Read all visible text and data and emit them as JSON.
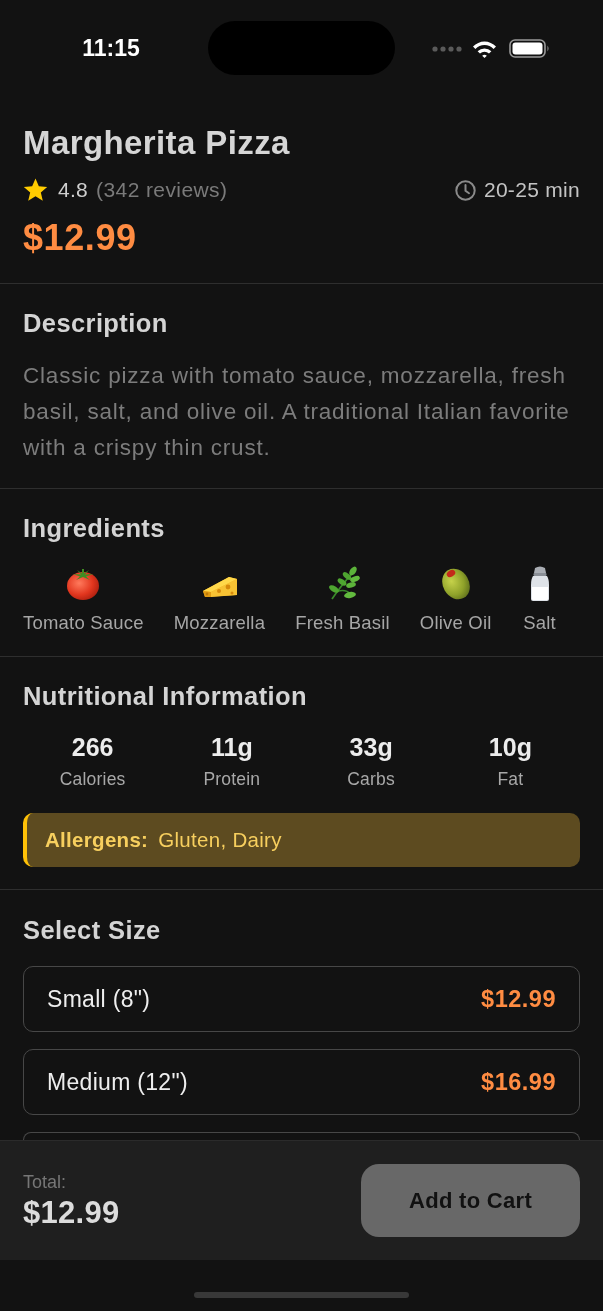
{
  "status_bar": {
    "time": "11:15"
  },
  "item": {
    "title": "Margherita Pizza",
    "rating": "4.8",
    "reviews": "(342 reviews)",
    "prep_time": "20-25 min",
    "price": "$12.99"
  },
  "description": {
    "heading": "Description",
    "text": "Classic pizza with tomato sauce, mozzarella, fresh basil, salt, and olive oil. A traditional Italian favorite with a crispy thin crust."
  },
  "ingredients": {
    "heading": "Ingredients",
    "items": [
      {
        "kind": "tomato",
        "name": "Tomato Sauce"
      },
      {
        "kind": "cheese",
        "name": "Mozzarella"
      },
      {
        "kind": "herb",
        "name": "Fresh Basil"
      },
      {
        "kind": "olive",
        "name": "Olive Oil"
      },
      {
        "kind": "salt",
        "name": "Salt"
      }
    ]
  },
  "nutrition": {
    "heading": "Nutritional Information",
    "facts": [
      {
        "value": "266",
        "label": "Calories"
      },
      {
        "value": "11g",
        "label": "Protein"
      },
      {
        "value": "33g",
        "label": "Carbs"
      },
      {
        "value": "10g",
        "label": "Fat"
      }
    ],
    "allergens": "**Allergens:** Gluten, Dairy"
  },
  "sizes": {
    "heading": "Select Size",
    "options": [
      {
        "kind": "option",
        "label": "Small (8\")",
        "price": "$12.99"
      },
      {
        "kind": "option",
        "label": "Medium (12\")",
        "price": "$16.99"
      },
      {
        "kind": "cut_off"
      }
    ]
  },
  "footer": {
    "total_label": "Total:",
    "total": "$12.99",
    "button": "Add to Cart"
  }
}
